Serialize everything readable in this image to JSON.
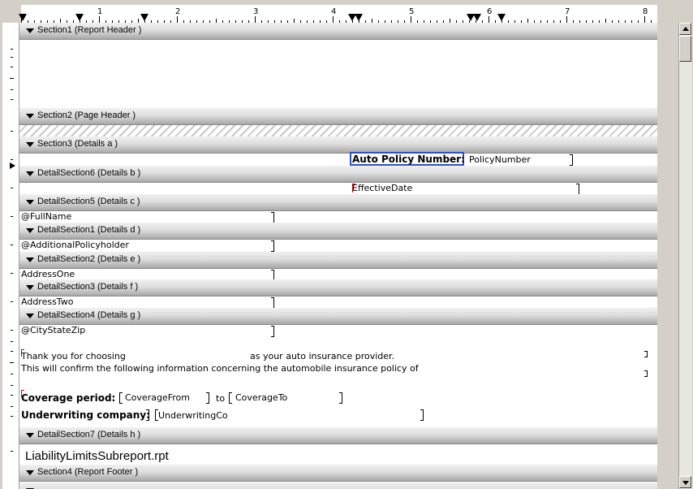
{
  "ruler": {
    "numbers": [
      "1",
      "2",
      "3",
      "4",
      "5",
      "6",
      "7",
      "8"
    ]
  },
  "sections": [
    {
      "label": "Section1 (Report Header  )"
    },
    {
      "label": "Section2 (Page Header  )"
    },
    {
      "label": "Section3 (Details a )"
    },
    {
      "label": "DetailSection6 (Details b )"
    },
    {
      "label": "DetailSection5 (Details c )"
    },
    {
      "label": "DetailSection1 (Details d )"
    },
    {
      "label": "DetailSection2 (Details e )"
    },
    {
      "label": "DetailSection3 (Details f )"
    },
    {
      "label": "DetailSection4 (Details g )"
    },
    {
      "label": "DetailSection7 (Details h )"
    },
    {
      "label": "Section4 (Report Footer  )"
    }
  ],
  "fields": {
    "auto_policy_label": "Auto Policy Number:",
    "policy_number": "PolicyNumber",
    "effective_date": "EffectiveDate",
    "full_name": "@FullName",
    "additional_policyholder": "@AdditionalPolicyholder",
    "address_one": "AddressOne",
    "address_two": "AddressTwo",
    "city_state_zip": "@CityStateZip",
    "thank_you_a": "Thank you for choosing",
    "thank_you_b": "as your auto insurance provider.",
    "confirm_text": "This will confirm the following information concerning the automobile  insurance policy of",
    "coverage_label": "Coverage period:",
    "coverage_from": "CoverageFrom",
    "to_text": "to",
    "coverage_to": "CoverageTo",
    "underwriting_label": "Underwriting company:",
    "underwriting_co": "UnderwritingCo",
    "subreport": "LiabilityLimitsSubreport.rpt"
  },
  "colors": {
    "selection": "#3050c8",
    "guide_red": "#cc0000"
  }
}
